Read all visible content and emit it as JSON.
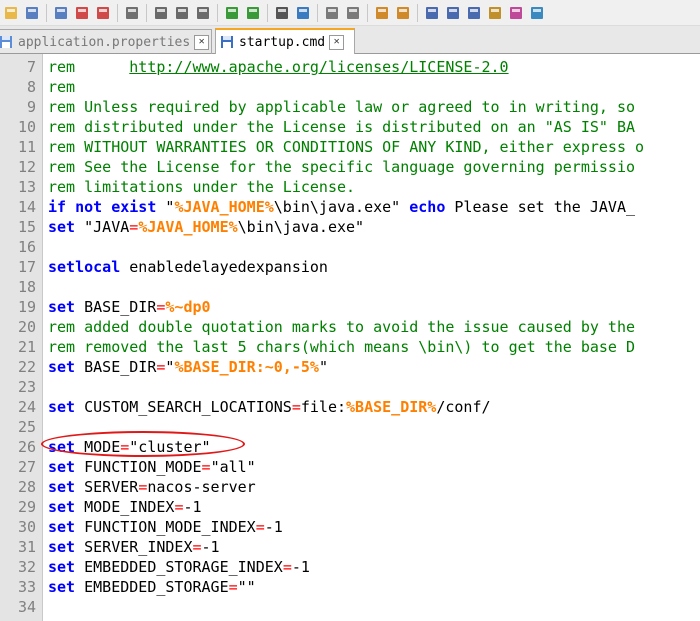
{
  "tabs": [
    {
      "label": "application.properties",
      "active": false
    },
    {
      "label": "startup.cmd",
      "active": true
    }
  ],
  "toolbar_icons": [
    "open-icon",
    "save-icon",
    "save-all-icon",
    "close-icon",
    "close-all-icon",
    "print-icon",
    "cut-icon",
    "copy-icon",
    "paste-icon",
    "undo-icon",
    "redo-icon",
    "find-icon",
    "replace-icon",
    "zoom-in-icon",
    "zoom-out-icon",
    "sync-v-icon",
    "sync-h-icon",
    "wrap-icon",
    "show-all-icon",
    "indent-guide-icon",
    "lang-icon",
    "doc-map-icon",
    "func-list-icon"
  ],
  "lines": [
    {
      "n": "7",
      "t": [
        [
          "cm",
          "rem      "
        ],
        [
          "url",
          "http://www.apache.org/licenses/LICENSE-2.0"
        ]
      ]
    },
    {
      "n": "8",
      "t": [
        [
          "cm",
          "rem"
        ]
      ]
    },
    {
      "n": "9",
      "t": [
        [
          "cm",
          "rem Unless required by applicable law or agreed to in writing, so"
        ]
      ]
    },
    {
      "n": "10",
      "t": [
        [
          "cm",
          "rem distributed under the License is distributed on an \"AS IS\" BA"
        ]
      ]
    },
    {
      "n": "11",
      "t": [
        [
          "cm",
          "rem WITHOUT WARRANTIES OR CONDITIONS OF ANY KIND, either express o"
        ]
      ]
    },
    {
      "n": "12",
      "t": [
        [
          "cm",
          "rem See the License for the specific language governing permissio"
        ]
      ]
    },
    {
      "n": "13",
      "t": [
        [
          "cm",
          "rem limitations under the License."
        ]
      ]
    },
    {
      "n": "14",
      "t": [
        [
          "kw",
          "if not exist"
        ],
        [
          "str",
          " \""
        ],
        [
          "vr",
          "%JAVA_HOME%"
        ],
        [
          "str",
          "\\bin\\java.exe\" "
        ],
        [
          "kw",
          "echo"
        ],
        [
          "str",
          " Please set the JAVA_"
        ]
      ]
    },
    {
      "n": "15",
      "t": [
        [
          "kw",
          "set"
        ],
        [
          "str",
          " \"JAVA"
        ],
        [
          "op",
          "="
        ],
        [
          "vr",
          "%JAVA_HOME%"
        ],
        [
          "str",
          "\\bin\\java.exe\""
        ]
      ]
    },
    {
      "n": "16",
      "t": []
    },
    {
      "n": "17",
      "t": [
        [
          "kw",
          "setlocal"
        ],
        [
          "str",
          " enabledelayedexpansion"
        ]
      ]
    },
    {
      "n": "18",
      "t": []
    },
    {
      "n": "19",
      "t": [
        [
          "kw",
          "set"
        ],
        [
          "str",
          " BASE_DIR"
        ],
        [
          "op",
          "="
        ],
        [
          "vr",
          "%~dp0"
        ]
      ]
    },
    {
      "n": "20",
      "t": [
        [
          "cm",
          "rem added double quotation marks to avoid the issue caused by the"
        ]
      ]
    },
    {
      "n": "21",
      "t": [
        [
          "cm",
          "rem removed the last 5 chars(which means \\bin\\) to get the base D"
        ]
      ]
    },
    {
      "n": "22",
      "t": [
        [
          "kw",
          "set"
        ],
        [
          "str",
          " BASE_DIR"
        ],
        [
          "op",
          "="
        ],
        [
          "str",
          "\""
        ],
        [
          "vr",
          "%BASE_DIR:~0,-5%"
        ],
        [
          "str",
          "\""
        ]
      ]
    },
    {
      "n": "23",
      "t": []
    },
    {
      "n": "24",
      "t": [
        [
          "kw",
          "set"
        ],
        [
          "str",
          " CUSTOM_SEARCH_LOCATIONS"
        ],
        [
          "op",
          "="
        ],
        [
          "str",
          "file:"
        ],
        [
          "vr",
          "%BASE_DIR%"
        ],
        [
          "str",
          "/conf/"
        ]
      ]
    },
    {
      "n": "25",
      "t": []
    },
    {
      "n": "26",
      "t": [
        [
          "kw",
          "set"
        ],
        [
          "str",
          " MODE"
        ],
        [
          "op",
          "="
        ],
        [
          "str",
          "\"cluster\""
        ]
      ]
    },
    {
      "n": "27",
      "t": [
        [
          "kw",
          "set"
        ],
        [
          "str",
          " FUNCTION_MODE"
        ],
        [
          "op",
          "="
        ],
        [
          "str",
          "\"all\""
        ]
      ]
    },
    {
      "n": "28",
      "t": [
        [
          "kw",
          "set"
        ],
        [
          "str",
          " SERVER"
        ],
        [
          "op",
          "="
        ],
        [
          "str",
          "nacos-server"
        ]
      ]
    },
    {
      "n": "29",
      "t": [
        [
          "kw",
          "set"
        ],
        [
          "str",
          " MODE_INDEX"
        ],
        [
          "op",
          "="
        ],
        [
          "str",
          "-1"
        ]
      ]
    },
    {
      "n": "30",
      "t": [
        [
          "kw",
          "set"
        ],
        [
          "str",
          " FUNCTION_MODE_INDEX"
        ],
        [
          "op",
          "="
        ],
        [
          "str",
          "-1"
        ]
      ]
    },
    {
      "n": "31",
      "t": [
        [
          "kw",
          "set"
        ],
        [
          "str",
          " SERVER_INDEX"
        ],
        [
          "op",
          "="
        ],
        [
          "str",
          "-1"
        ]
      ]
    },
    {
      "n": "32",
      "t": [
        [
          "kw",
          "set"
        ],
        [
          "str",
          " EMBEDDED_STORAGE_INDEX"
        ],
        [
          "op",
          "="
        ],
        [
          "str",
          "-1"
        ]
      ]
    },
    {
      "n": "33",
      "t": [
        [
          "kw",
          "set"
        ],
        [
          "str",
          " EMBEDDED_STORAGE"
        ],
        [
          "op",
          "="
        ],
        [
          "str",
          "\"\""
        ]
      ]
    },
    {
      "n": "34",
      "t": []
    }
  ],
  "colors": {
    "keyword": "#0000ff",
    "comment": "#008000",
    "operator": "#ff0000",
    "variable": "#ff8000",
    "highlight": "#e01818"
  }
}
